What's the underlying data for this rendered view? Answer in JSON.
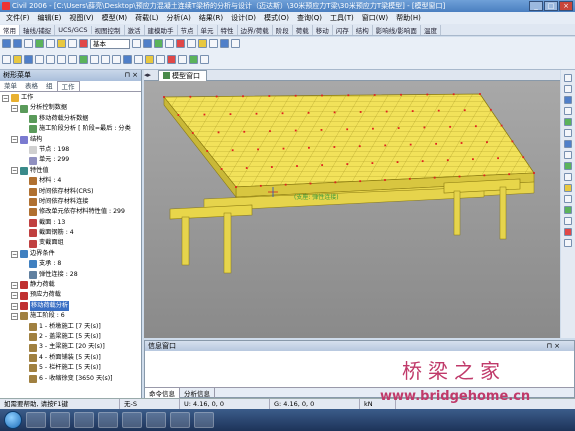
{
  "window": {
    "title": "Civil 2006 - [C:\\Users\\薛亮\\Desktop\\预应力混凝土连续T梁桥的分析与设计（迈达斯）\\30米预应力T梁\\30米预应力T梁模型] - [模型窗口]"
  },
  "menu": [
    "文件(F)",
    "编辑(E)",
    "视图(V)",
    "模型(M)",
    "荷载(L)",
    "分析(A)",
    "结果(R)",
    "设计(D)",
    "模式(O)",
    "查询(Q)",
    "工具(T)",
    "窗口(W)",
    "帮助(H)"
  ],
  "tabs": [
    "常用",
    "轴线/捕捉",
    "UCS/GCS",
    "视图控制",
    "激活",
    "建模助手",
    "节点",
    "单元",
    "特性",
    "边界/荷载",
    "阶段",
    "荷载",
    "移动",
    "闪存",
    "结构",
    "影响线/影响面",
    "温度"
  ],
  "toolbar": {
    "combo_value": "基本"
  },
  "tree": {
    "header": "树形菜单",
    "tabs": [
      "菜单",
      "表格",
      "组",
      "工作"
    ],
    "nodes": [
      {
        "label": "工作",
        "level": 0,
        "icon": "work-icon"
      },
      {
        "label": "分析控制数据",
        "level": 1,
        "icon": "folder-icon"
      },
      {
        "label": "移动荷载分析数据",
        "level": 2,
        "icon": "data-icon"
      },
      {
        "label": "施工阶段分析 [ 阶段=最后 : 分类",
        "level": 2,
        "icon": "data-icon"
      },
      {
        "label": "结构",
        "level": 1,
        "icon": "structure-icon"
      },
      {
        "label": "节点 : 198",
        "level": 2,
        "icon": "node-icon"
      },
      {
        "label": "单元 : 299",
        "level": 2,
        "icon": "element-icon"
      },
      {
        "label": "特性值",
        "level": 1,
        "icon": "property-icon"
      },
      {
        "label": "材料 : 4",
        "level": 2,
        "icon": "material-icon"
      },
      {
        "label": "时间依存材料(CRS)",
        "level": 2,
        "icon": "material-icon"
      },
      {
        "label": "时间依存材料连接",
        "level": 2,
        "icon": "material-icon"
      },
      {
        "label": "修改单元依存材料特性值 : 299",
        "level": 2,
        "icon": "material-icon"
      },
      {
        "label": "截面 : 13",
        "level": 2,
        "icon": "section-icon"
      },
      {
        "label": "截面钢筋 : 4",
        "level": 2,
        "icon": "section-icon"
      },
      {
        "label": "变截面组",
        "level": 2,
        "icon": "section-icon"
      },
      {
        "label": "边界条件",
        "level": 1,
        "icon": "boundary-icon"
      },
      {
        "label": "支承 : 8",
        "level": 2,
        "icon": "support-icon"
      },
      {
        "label": "弹性连接 : 28",
        "level": 2,
        "icon": "link-icon"
      },
      {
        "label": "静力荷载",
        "level": 1,
        "icon": "load-icon"
      },
      {
        "label": "预应力荷载",
        "level": 1,
        "icon": "load-icon"
      },
      {
        "label": "移动荷载分析",
        "level": 1,
        "icon": "moving-load-icon",
        "selected": true
      },
      {
        "label": "施工阶段 : 6",
        "level": 1,
        "icon": "stage-icon"
      },
      {
        "label": "1 - 桥墩施工 [7 天(s)]",
        "level": 2,
        "icon": "stage-icon"
      },
      {
        "label": "2 - 盖梁施工 [5 天(s)]",
        "level": 2,
        "icon": "stage-icon"
      },
      {
        "label": "3 - 主梁施工 [20 天(s)]",
        "level": 2,
        "icon": "stage-icon"
      },
      {
        "label": "4 - 桥面铺装 [5 天(s)]",
        "level": 2,
        "icon": "stage-icon"
      },
      {
        "label": "5 - 栏杆施工 [5 天(s)]",
        "level": 2,
        "icon": "stage-icon"
      },
      {
        "label": "6 - 收缩徐变 [3650 天(s)]",
        "level": 2,
        "icon": "stage-icon"
      }
    ]
  },
  "viewport": {
    "tab": "模型窗口",
    "label": "(支座: 弹性连接)"
  },
  "info": {
    "title": "信息窗口",
    "tabs": [
      "命令信息",
      "分析信息"
    ]
  },
  "status": {
    "hint": "如需要帮助, 请按F1键",
    "none": "无-S",
    "u": "U: 4.16, 0, 0",
    "g": "G: 4.16, 0, 0",
    "unit": "kN"
  },
  "watermark": {
    "cn": "桥梁之家",
    "url": "www.bridgehome.cn"
  },
  "colors": {
    "model_fill": "#f2e25a",
    "model_stroke": "#8a7a10",
    "node_marker": "#e02020",
    "selection": "#3a6fc4"
  }
}
